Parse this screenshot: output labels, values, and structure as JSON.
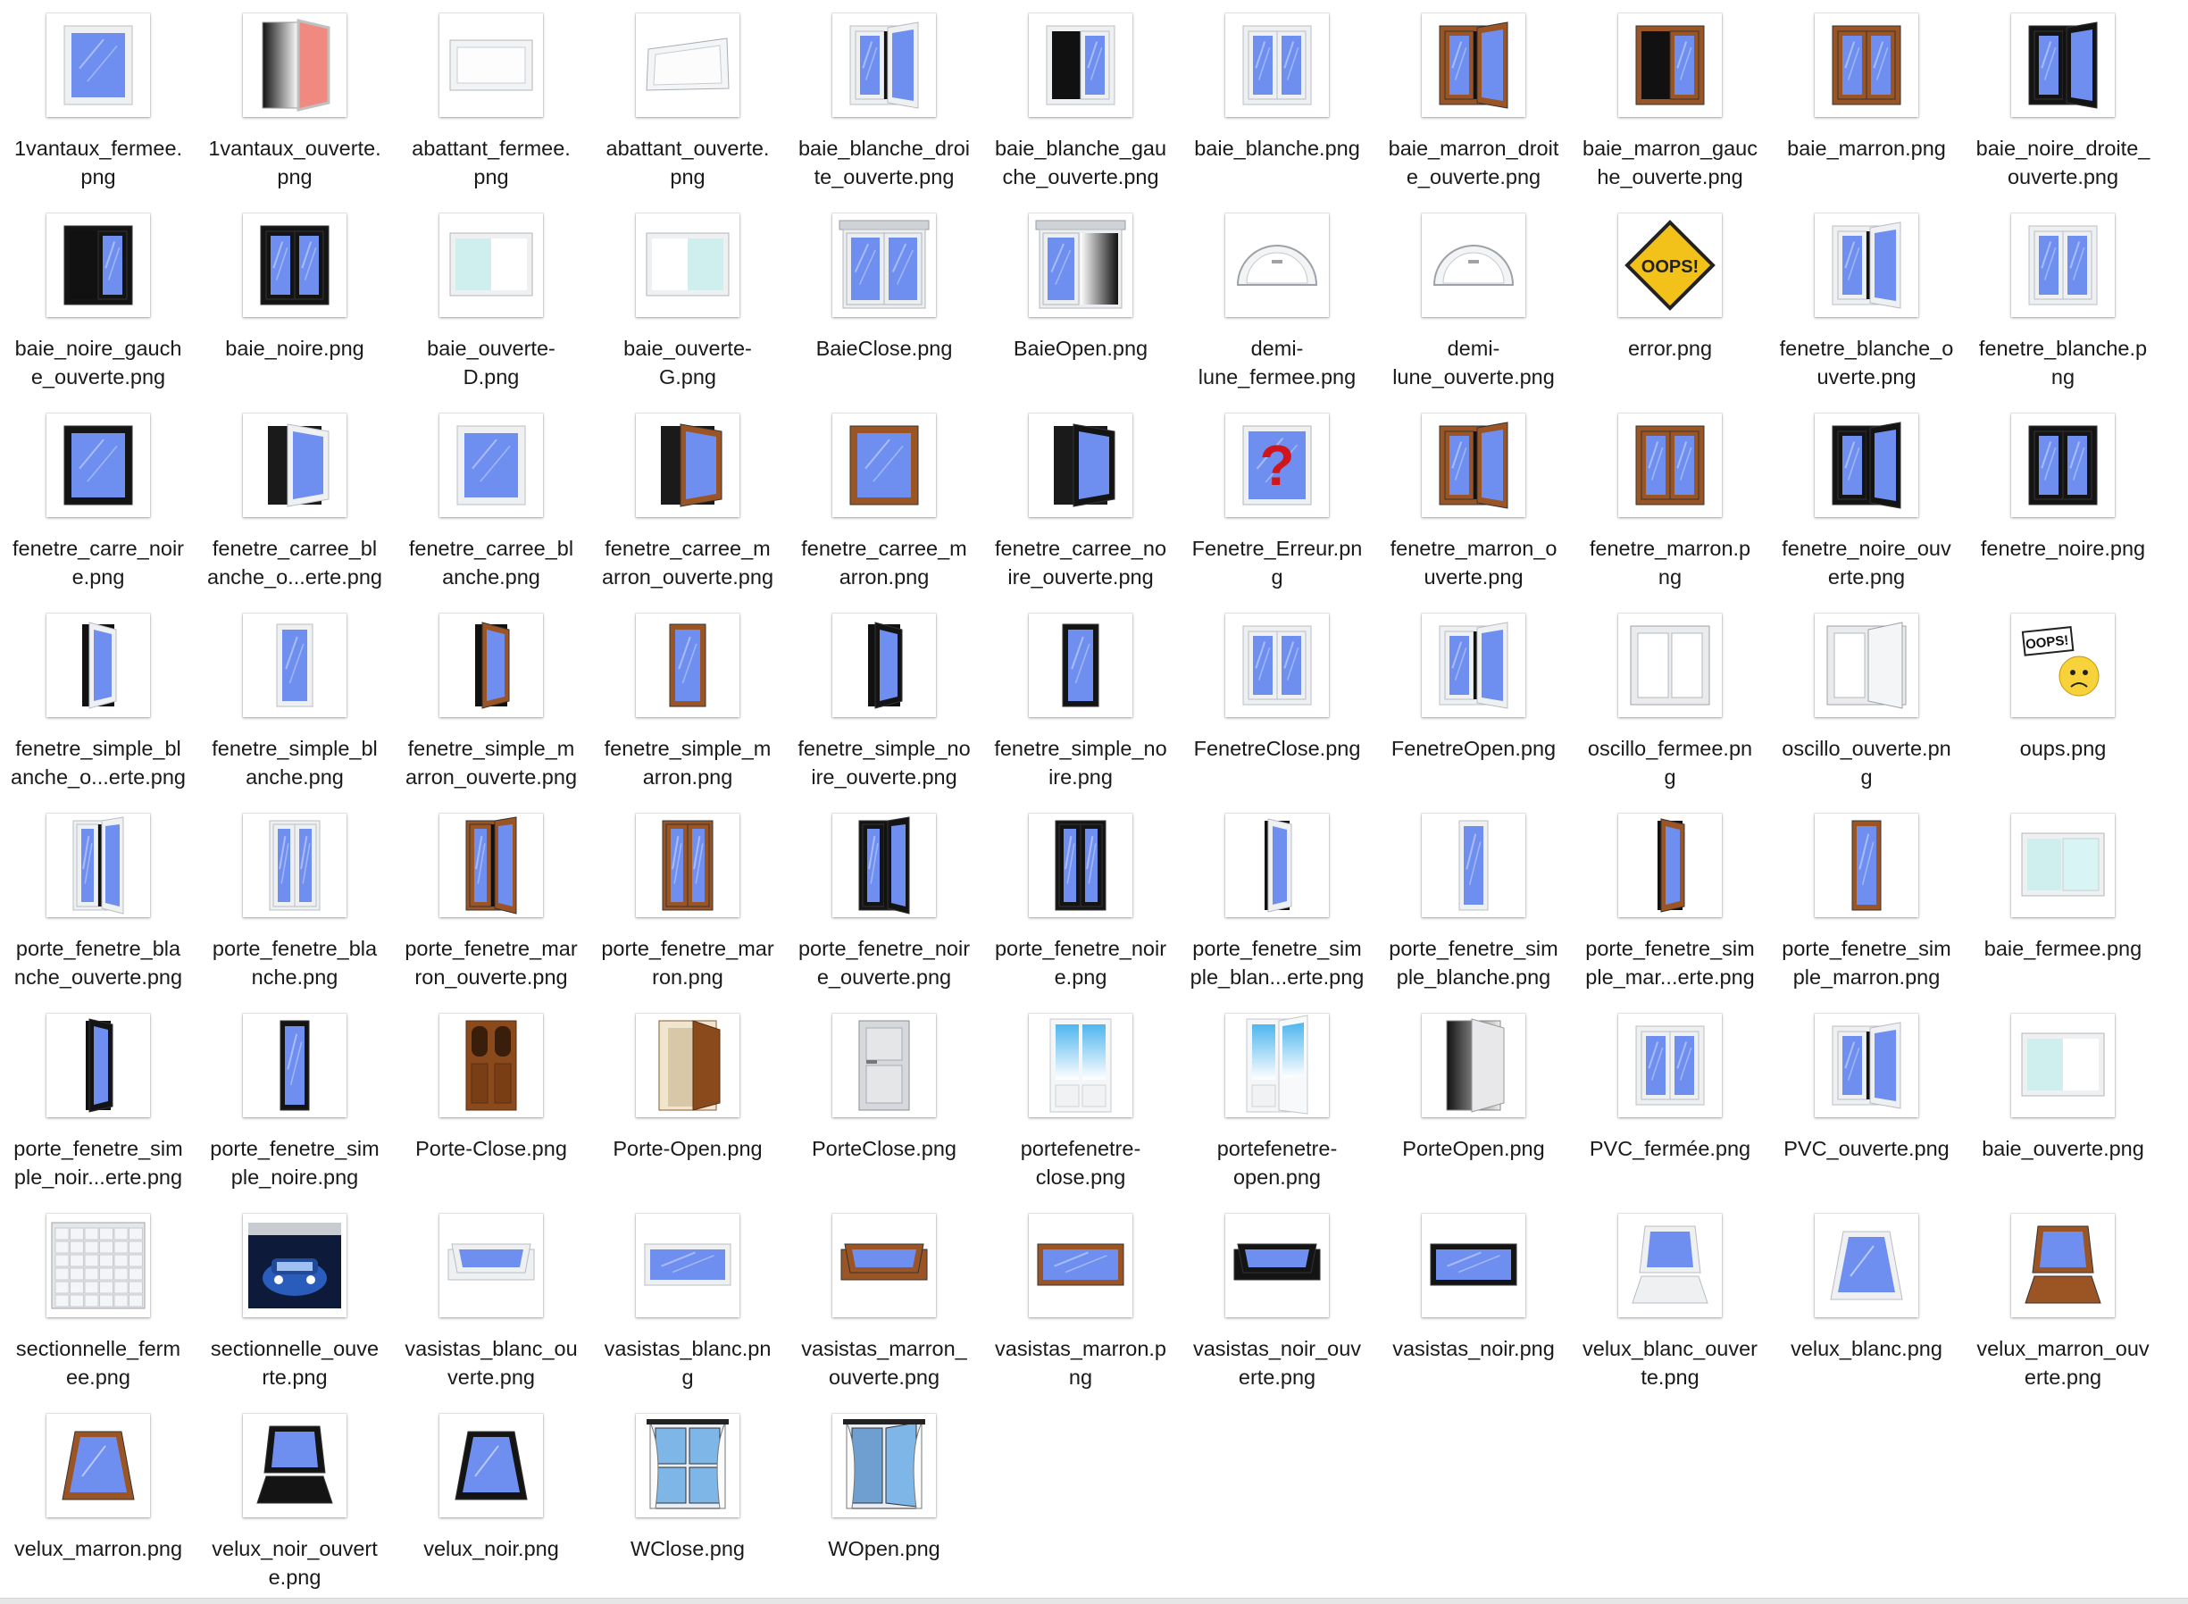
{
  "colors": {
    "glass": "#6f8ff0",
    "frame_white": "#eef0f2",
    "frame_brown": "#9b5424",
    "frame_black": "#141414",
    "label_text": "#1a1a1a"
  },
  "files": [
    {
      "line1": "1vantaux_fermee.",
      "line2": "png",
      "icon": "window-single-white-closed-icon",
      "kind": "single",
      "frame": "white",
      "state": "closed"
    },
    {
      "line1": "1vantaux_ouverte.",
      "line2": "png",
      "icon": "window-single-open-gradient-icon",
      "kind": "open-red",
      "frame": "white",
      "state": "open"
    },
    {
      "line1": "abattant_fermee.",
      "line2": "png",
      "icon": "window-tilt-white-closed-icon",
      "kind": "tilt",
      "frame": "white",
      "state": "closed"
    },
    {
      "line1": "abattant_ouverte.",
      "line2": "png",
      "icon": "window-tilt-white-open-icon",
      "kind": "tilt",
      "frame": "white",
      "state": "open"
    },
    {
      "line1": "baie_blanche_droi",
      "line2": "te_ouverte.png",
      "icon": "window-double-white-right-open-icon",
      "kind": "double",
      "frame": "white",
      "state": "right"
    },
    {
      "line1": "baie_blanche_gau",
      "line2": "che_ouverte.png",
      "icon": "window-double-white-left-open-icon",
      "kind": "double",
      "frame": "white",
      "state": "left"
    },
    {
      "line1": "baie_blanche.png",
      "line2": "",
      "icon": "window-double-white-closed-icon",
      "kind": "double",
      "frame": "white",
      "state": "closed"
    },
    {
      "line1": "baie_marron_droit",
      "line2": "e_ouverte.png",
      "icon": "window-double-brown-right-open-icon",
      "kind": "double",
      "frame": "brown",
      "state": "right"
    },
    {
      "line1": "baie_marron_gauc",
      "line2": "he_ouverte.png",
      "icon": "window-double-brown-left-open-icon",
      "kind": "double",
      "frame": "brown",
      "state": "left"
    },
    {
      "line1": "baie_marron.png",
      "line2": "",
      "icon": "window-double-brown-closed-icon",
      "kind": "double",
      "frame": "brown",
      "state": "closed"
    },
    {
      "line1": "baie_noire_droite_",
      "line2": "ouverte.png",
      "icon": "window-double-black-right-open-icon",
      "kind": "double",
      "frame": "black",
      "state": "right"
    },
    {
      "line1": "baie_noire_gauch",
      "line2": "e_ouverte.png",
      "icon": "window-double-black-left-open-icon",
      "kind": "double",
      "frame": "black",
      "state": "left"
    },
    {
      "line1": "baie_noire.png",
      "line2": "",
      "icon": "window-double-black-closed-icon",
      "kind": "double",
      "frame": "black",
      "state": "closed"
    },
    {
      "line1": "baie_ouverte-",
      "line2": "D.png",
      "icon": "sliding-door-right-open-icon",
      "kind": "slide",
      "frame": "white",
      "state": "right"
    },
    {
      "line1": "baie_ouverte-",
      "line2": "G.png",
      "icon": "sliding-door-left-open-icon",
      "kind": "slide",
      "frame": "white",
      "state": "left"
    },
    {
      "line1": "BaieClose.png",
      "line2": "",
      "icon": "bay-window-closed-icon",
      "kind": "bay",
      "frame": "white",
      "state": "closed"
    },
    {
      "line1": "BaieOpen.png",
      "line2": "",
      "icon": "bay-window-open-icon",
      "kind": "bay",
      "frame": "white",
      "state": "open"
    },
    {
      "line1": "demi-",
      "line2": "lune_fermee.png",
      "icon": "half-moon-window-closed-icon",
      "kind": "halfmoon",
      "frame": "white",
      "state": "closed"
    },
    {
      "line1": "demi-",
      "line2": "lune_ouverte.png",
      "icon": "half-moon-window-open-icon",
      "kind": "halfmoon",
      "frame": "white",
      "state": "open"
    },
    {
      "line1": "error.png",
      "line2": "",
      "icon": "oops-warning-sign-icon",
      "kind": "error",
      "frame": "white",
      "state": "closed"
    },
    {
      "line1": "fenetre_blanche_o",
      "line2": "uverte.png",
      "icon": "window-white-open-icon",
      "kind": "double",
      "frame": "white",
      "state": "right"
    },
    {
      "line1": "fenetre_blanche.p",
      "line2": "ng",
      "icon": "window-white-closed-icon",
      "kind": "double",
      "frame": "white",
      "state": "closed"
    },
    {
      "line1": "fenetre_carre_noir",
      "line2": "e.png",
      "icon": "square-window-black-closed-icon",
      "kind": "single",
      "frame": "black",
      "state": "closed"
    },
    {
      "line1": "fenetre_carree_bl",
      "line2": "anche_o...erte.png",
      "icon": "square-window-white-open-icon",
      "kind": "single",
      "frame": "white",
      "state": "open"
    },
    {
      "line1": "fenetre_carree_bl",
      "line2": "anche.png",
      "icon": "square-window-white-closed-icon",
      "kind": "single",
      "frame": "white",
      "state": "closed"
    },
    {
      "line1": "fenetre_carree_m",
      "line2": "arron_ouverte.png",
      "icon": "square-window-brown-open-icon",
      "kind": "single",
      "frame": "brown",
      "state": "open"
    },
    {
      "line1": "fenetre_carree_m",
      "line2": "arron.png",
      "icon": "square-window-brown-closed-icon",
      "kind": "single",
      "frame": "brown",
      "state": "closed"
    },
    {
      "line1": "fenetre_carree_no",
      "line2": "ire_ouverte.png",
      "icon": "square-window-black-open-icon",
      "kind": "single",
      "frame": "black",
      "state": "open"
    },
    {
      "line1": "Fenetre_Erreur.pn",
      "line2": "g",
      "icon": "window-question-mark-icon",
      "kind": "question",
      "frame": "white",
      "state": "closed"
    },
    {
      "line1": "fenetre_marron_o",
      "line2": "uverte.png",
      "icon": "window-brown-open-icon",
      "kind": "double",
      "frame": "brown",
      "state": "right"
    },
    {
      "line1": "fenetre_marron.p",
      "line2": "ng",
      "icon": "window-brown-closed-icon",
      "kind": "double",
      "frame": "brown",
      "state": "closed"
    },
    {
      "line1": "fenetre_noire_ouv",
      "line2": "erte.png",
      "icon": "window-black-open-icon",
      "kind": "double",
      "frame": "black",
      "state": "right"
    },
    {
      "line1": "fenetre_noire.png",
      "line2": "",
      "icon": "window-black-closed-icon",
      "kind": "double",
      "frame": "black",
      "state": "closed"
    },
    {
      "line1": "fenetre_simple_bl",
      "line2": "anche_o...erte.png",
      "icon": "narrow-window-white-open-icon",
      "kind": "narrow",
      "frame": "white",
      "state": "open"
    },
    {
      "line1": "fenetre_simple_bl",
      "line2": "anche.png",
      "icon": "narrow-window-white-closed-icon",
      "kind": "narrow",
      "frame": "white",
      "state": "closed"
    },
    {
      "line1": "fenetre_simple_m",
      "line2": "arron_ouverte.png",
      "icon": "narrow-window-brown-open-icon",
      "kind": "narrow",
      "frame": "brown",
      "state": "open"
    },
    {
      "line1": "fenetre_simple_m",
      "line2": "arron.png",
      "icon": "narrow-window-brown-closed-icon",
      "kind": "narrow",
      "frame": "brown",
      "state": "closed"
    },
    {
      "line1": "fenetre_simple_no",
      "line2": "ire_ouverte.png",
      "icon": "narrow-window-black-open-icon",
      "kind": "narrow",
      "frame": "black",
      "state": "open"
    },
    {
      "line1": "fenetre_simple_no",
      "line2": "ire.png",
      "icon": "narrow-window-black-closed-icon",
      "kind": "narrow",
      "frame": "black",
      "state": "closed"
    },
    {
      "line1": "FenetreClose.png",
      "line2": "",
      "icon": "window-closed-icon",
      "kind": "double",
      "frame": "white",
      "state": "closed"
    },
    {
      "line1": "FenetreOpen.png",
      "line2": "",
      "icon": "window-open-icon",
      "kind": "double",
      "frame": "white",
      "state": "right"
    },
    {
      "line1": "oscillo_fermee.pn",
      "line2": "g",
      "icon": "tilt-turn-window-closed-icon",
      "kind": "oscillo",
      "frame": "white",
      "state": "closed"
    },
    {
      "line1": "oscillo_ouverte.pn",
      "line2": "g",
      "icon": "tilt-turn-window-open-icon",
      "kind": "oscillo",
      "frame": "white",
      "state": "open"
    },
    {
      "line1": "oups.png",
      "line2": "",
      "icon": "oops-smiley-sign-icon",
      "kind": "oups",
      "frame": "white",
      "state": "closed"
    },
    {
      "line1": "porte_fenetre_bla",
      "line2": "nche_ouverte.png",
      "icon": "french-door-white-open-icon",
      "kind": "tall",
      "frame": "white",
      "state": "open"
    },
    {
      "line1": "porte_fenetre_bla",
      "line2": "nche.png",
      "icon": "french-door-white-closed-icon",
      "kind": "tall",
      "frame": "white",
      "state": "closed"
    },
    {
      "line1": "porte_fenetre_mar",
      "line2": "ron_ouverte.png",
      "icon": "french-door-brown-open-icon",
      "kind": "tall",
      "frame": "brown",
      "state": "open"
    },
    {
      "line1": "porte_fenetre_mar",
      "line2": "ron.png",
      "icon": "french-door-brown-closed-icon",
      "kind": "tall",
      "frame": "brown",
      "state": "closed"
    },
    {
      "line1": "porte_fenetre_noir",
      "line2": "e_ouverte.png",
      "icon": "french-door-black-open-icon",
      "kind": "tall",
      "frame": "black",
      "state": "open"
    },
    {
      "line1": "porte_fenetre_noir",
      "line2": "e.png",
      "icon": "french-door-black-closed-icon",
      "kind": "tall",
      "frame": "black",
      "state": "closed"
    },
    {
      "line1": "porte_fenetre_sim",
      "line2": "ple_blan...erte.png",
      "icon": "single-french-door-white-open-icon",
      "kind": "tallnarrow",
      "frame": "white",
      "state": "open"
    },
    {
      "line1": "porte_fenetre_sim",
      "line2": "ple_blanche.png",
      "icon": "single-french-door-white-closed-icon",
      "kind": "tallnarrow",
      "frame": "white",
      "state": "closed"
    },
    {
      "line1": "porte_fenetre_sim",
      "line2": "ple_mar...erte.png",
      "icon": "single-french-door-brown-open-icon",
      "kind": "tallnarrow",
      "frame": "brown",
      "state": "open"
    },
    {
      "line1": "porte_fenetre_sim",
      "line2": "ple_marron.png",
      "icon": "single-french-door-brown-closed-icon",
      "kind": "tallnarrow",
      "frame": "brown",
      "state": "closed"
    },
    {
      "line1": "baie_fermee.png",
      "line2": "",
      "icon": "sliding-bay-closed-icon",
      "kind": "slide",
      "frame": "white",
      "state": "closed"
    },
    {
      "line1": "porte_fenetre_sim",
      "line2": "ple_noir...erte.png",
      "icon": "single-french-door-black-open-icon",
      "kind": "tallnarrow",
      "frame": "black",
      "state": "open"
    },
    {
      "line1": "porte_fenetre_sim",
      "line2": "ple_noire.png",
      "icon": "single-french-door-black-closed-icon",
      "kind": "tallnarrow",
      "frame": "black",
      "state": "closed"
    },
    {
      "line1": "Porte-Close.png",
      "line2": "",
      "icon": "wooden-door-closed-icon",
      "kind": "door",
      "frame": "brown",
      "state": "closed"
    },
    {
      "line1": "Porte-Open.png",
      "line2": "",
      "icon": "wooden-door-open-icon",
      "kind": "door",
      "frame": "brown",
      "state": "open"
    },
    {
      "line1": "PorteClose.png",
      "line2": "",
      "icon": "grey-door-closed-icon",
      "kind": "greydoor",
      "frame": "white",
      "state": "closed"
    },
    {
      "line1": "portefenetre-",
      "line2": "close.png",
      "icon": "patio-door-closed-icon",
      "kind": "patio",
      "frame": "white",
      "state": "closed"
    },
    {
      "line1": "portefenetre-",
      "line2": "open.png",
      "icon": "patio-door-open-icon",
      "kind": "patio",
      "frame": "white",
      "state": "open"
    },
    {
      "line1": "PorteOpen.png",
      "line2": "",
      "icon": "grey-door-open-icon",
      "kind": "greydoor",
      "frame": "white",
      "state": "open"
    },
    {
      "line1": "PVC_fermée.png",
      "line2": "",
      "icon": "pvc-window-closed-icon",
      "kind": "double",
      "frame": "white",
      "state": "closed"
    },
    {
      "line1": "PVC_ouverte.png",
      "line2": "",
      "icon": "pvc-window-open-icon",
      "kind": "double",
      "frame": "white",
      "state": "right"
    },
    {
      "line1": "baie_ouverte.png",
      "line2": "",
      "icon": "sliding-bay-open-icon",
      "kind": "slide",
      "frame": "white",
      "state": "open"
    },
    {
      "line1": "sectionnelle_ferm",
      "line2": "ee.png",
      "icon": "garage-door-closed-icon",
      "kind": "garage",
      "frame": "white",
      "state": "closed"
    },
    {
      "line1": "sectionnelle_ouve",
      "line2": "rte.png",
      "icon": "garage-door-open-car-icon",
      "kind": "garage",
      "frame": "white",
      "state": "open"
    },
    {
      "line1": "vasistas_blanc_ou",
      "line2": "verte.png",
      "icon": "transom-white-open-icon",
      "kind": "transom",
      "frame": "white",
      "state": "open"
    },
    {
      "line1": "vasistas_blanc.pn",
      "line2": "g",
      "icon": "transom-white-closed-icon",
      "kind": "transom",
      "frame": "white",
      "state": "closed"
    },
    {
      "line1": "vasistas_marron_",
      "line2": "ouverte.png",
      "icon": "transom-brown-open-icon",
      "kind": "transom",
      "frame": "brown",
      "state": "open"
    },
    {
      "line1": "vasistas_marron.p",
      "line2": "ng",
      "icon": "transom-brown-closed-icon",
      "kind": "transom",
      "frame": "brown",
      "state": "closed"
    },
    {
      "line1": "vasistas_noir_ouv",
      "line2": "erte.png",
      "icon": "transom-black-open-icon",
      "kind": "transom",
      "frame": "black",
      "state": "open"
    },
    {
      "line1": "vasistas_noir.png",
      "line2": "",
      "icon": "transom-black-closed-icon",
      "kind": "transom",
      "frame": "black",
      "state": "closed"
    },
    {
      "line1": "velux_blanc_ouver",
      "line2": "te.png",
      "icon": "skylight-white-open-icon",
      "kind": "velux",
      "frame": "white",
      "state": "open"
    },
    {
      "line1": "velux_blanc.png",
      "line2": "",
      "icon": "skylight-white-closed-icon",
      "kind": "velux",
      "frame": "white",
      "state": "closed"
    },
    {
      "line1": "velux_marron_ouv",
      "line2": "erte.png",
      "icon": "skylight-brown-open-icon",
      "kind": "velux",
      "frame": "brown",
      "state": "open"
    },
    {
      "line1": "velux_marron.png",
      "line2": "",
      "icon": "skylight-brown-closed-icon",
      "kind": "velux",
      "frame": "brown",
      "state": "closed"
    },
    {
      "line1": "velux_noir_ouvert",
      "line2": "e.png",
      "icon": "skylight-black-open-icon",
      "kind": "velux",
      "frame": "black",
      "state": "open"
    },
    {
      "line1": "velux_noir.png",
      "line2": "",
      "icon": "skylight-black-closed-icon",
      "kind": "velux",
      "frame": "black",
      "state": "closed"
    },
    {
      "line1": "WClose.png",
      "line2": "",
      "icon": "window-curtains-closed-icon",
      "kind": "wcurtain",
      "frame": "white",
      "state": "closed"
    },
    {
      "line1": "WOpen.png",
      "line2": "",
      "icon": "window-curtains-open-icon",
      "kind": "wcurtain",
      "frame": "white",
      "state": "open"
    }
  ]
}
